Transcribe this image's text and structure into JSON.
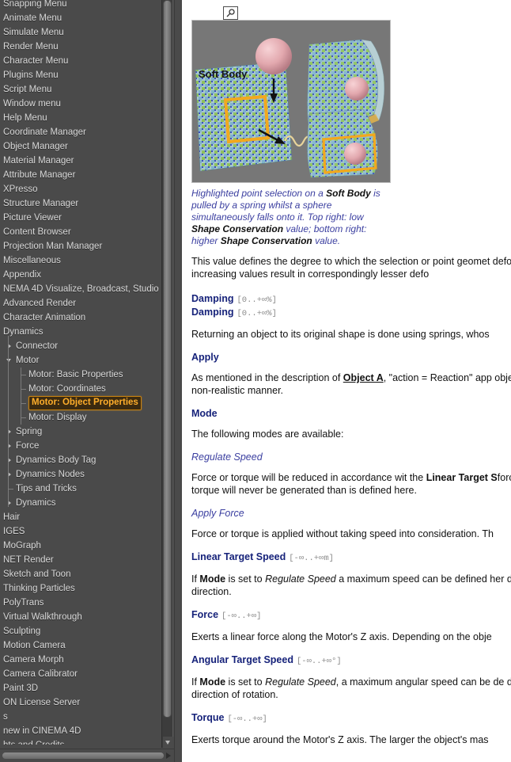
{
  "sidebar": {
    "items": [
      {
        "label": "Snapping Menu",
        "depth": 0,
        "twisty": "none",
        "selected": false,
        "clipped_top": true
      },
      {
        "label": "Animate Menu",
        "depth": 0,
        "twisty": "none",
        "selected": false
      },
      {
        "label": "Simulate Menu",
        "depth": 0,
        "twisty": "none",
        "selected": false
      },
      {
        "label": "Render Menu",
        "depth": 0,
        "twisty": "none",
        "selected": false
      },
      {
        "label": "Character Menu",
        "depth": 0,
        "twisty": "none",
        "selected": false
      },
      {
        "label": "Plugins Menu",
        "depth": 0,
        "twisty": "none",
        "selected": false
      },
      {
        "label": "Script Menu",
        "depth": 0,
        "twisty": "none",
        "selected": false
      },
      {
        "label": "Window menu",
        "depth": 0,
        "twisty": "none",
        "selected": false
      },
      {
        "label": "Help Menu",
        "depth": 0,
        "twisty": "none",
        "selected": false
      },
      {
        "label": "Coordinate Manager",
        "depth": 0,
        "twisty": "none",
        "selected": false
      },
      {
        "label": "Object Manager",
        "depth": 0,
        "twisty": "none",
        "selected": false
      },
      {
        "label": "Material Manager",
        "depth": 0,
        "twisty": "none",
        "selected": false
      },
      {
        "label": "Attribute Manager",
        "depth": 0,
        "twisty": "none",
        "selected": false
      },
      {
        "label": "XPresso",
        "depth": 0,
        "twisty": "none",
        "selected": false
      },
      {
        "label": "Structure Manager",
        "depth": 0,
        "twisty": "none",
        "selected": false
      },
      {
        "label": "Picture Viewer",
        "depth": 0,
        "twisty": "none",
        "selected": false
      },
      {
        "label": "Content Browser",
        "depth": 0,
        "twisty": "none",
        "selected": false
      },
      {
        "label": "Projection Man Manager",
        "depth": 0,
        "twisty": "none",
        "selected": false
      },
      {
        "label": "Miscellaneous",
        "depth": 0,
        "twisty": "none",
        "selected": false
      },
      {
        "label": "Appendix",
        "depth": 0,
        "twisty": "none",
        "selected": false
      },
      {
        "label": "NEMA 4D Visualize, Broadcast, Studio",
        "depth": 0,
        "twisty": "none",
        "selected": false
      },
      {
        "label": "Advanced Render",
        "depth": 0,
        "twisty": "none",
        "selected": false
      },
      {
        "label": "Character Animation",
        "depth": 0,
        "twisty": "none",
        "selected": false
      },
      {
        "label": "Dynamics",
        "depth": 0,
        "twisty": "none",
        "selected": false
      },
      {
        "label": "Connector",
        "depth": 1,
        "twisty": "closed",
        "selected": false
      },
      {
        "label": "Motor",
        "depth": 1,
        "twisty": "open",
        "selected": false
      },
      {
        "label": "Motor: Basic Properties",
        "depth": 2,
        "twisty": "leaf",
        "selected": false
      },
      {
        "label": "Motor: Coordinates",
        "depth": 2,
        "twisty": "leaf",
        "selected": false
      },
      {
        "label": "Motor: Object Properties",
        "depth": 2,
        "twisty": "leaf",
        "selected": true
      },
      {
        "label": "Motor: Display",
        "depth": 2,
        "twisty": "leaf",
        "selected": false
      },
      {
        "label": "Spring",
        "depth": 1,
        "twisty": "closed",
        "selected": false
      },
      {
        "label": "Force",
        "depth": 1,
        "twisty": "closed",
        "selected": false
      },
      {
        "label": "Dynamics Body Tag",
        "depth": 1,
        "twisty": "closed",
        "selected": false
      },
      {
        "label": "Dynamics Nodes",
        "depth": 1,
        "twisty": "closed",
        "selected": false
      },
      {
        "label": "Tips and Tricks",
        "depth": 1,
        "twisty": "leaf",
        "selected": false
      },
      {
        "label": "Dynamics",
        "depth": 1,
        "twisty": "closed",
        "selected": false
      },
      {
        "label": "Hair",
        "depth": 0,
        "twisty": "none",
        "selected": false
      },
      {
        "label": "IGES",
        "depth": 0,
        "twisty": "none",
        "selected": false
      },
      {
        "label": "MoGraph",
        "depth": 0,
        "twisty": "none",
        "selected": false
      },
      {
        "label": "NET Render",
        "depth": 0,
        "twisty": "none",
        "selected": false
      },
      {
        "label": "Sketch and Toon",
        "depth": 0,
        "twisty": "none",
        "selected": false
      },
      {
        "label": "Thinking Particles",
        "depth": 0,
        "twisty": "none",
        "selected": false
      },
      {
        "label": "PolyTrans",
        "depth": 0,
        "twisty": "none",
        "selected": false
      },
      {
        "label": "Virtual Walkthrough",
        "depth": 0,
        "twisty": "none",
        "selected": false
      },
      {
        "label": "Sculpting",
        "depth": 0,
        "twisty": "none",
        "selected": false
      },
      {
        "label": "Motion Camera",
        "depth": 0,
        "twisty": "none",
        "selected": false
      },
      {
        "label": "Camera Morph",
        "depth": 0,
        "twisty": "none",
        "selected": false
      },
      {
        "label": "Camera Calibrator",
        "depth": 0,
        "twisty": "none",
        "selected": false
      },
      {
        "label": "Paint 3D",
        "depth": 0,
        "twisty": "none",
        "selected": false
      },
      {
        "label": "ON License Server",
        "depth": 0,
        "twisty": "none",
        "selected": false
      },
      {
        "label": "s",
        "depth": 0,
        "twisty": "none",
        "selected": false
      },
      {
        "label": "new in CINEMA 4D",
        "depth": 0,
        "twisty": "none",
        "selected": false
      },
      {
        "label": "hts and Credits",
        "depth": 0,
        "twisty": "none",
        "selected": false
      }
    ],
    "selected_label": "Motor: Object Properties",
    "selection_color": "#ffae2b",
    "background_color": "#4a4a4a"
  },
  "content": {
    "zoom_icon": "magnifier-icon",
    "figure": {
      "label": "Soft Body",
      "alt": "Soft body cloth plane with highlighted point selection pulled by a spring while a sphere falls onto it; two result views at right"
    },
    "caption": {
      "part1": "Highlighted point selection on a ",
      "bold1": "Soft Body",
      "part2": " is pulled by a spring whilst a sphere simultaneously falls onto it. Top right: low ",
      "bold2": "Shape Conservation",
      "part3": " value; bottom right: higher ",
      "bold3": "Shape Conservation",
      "part4": " value."
    },
    "para_shape": "This value defines the degree to which the selection or point geomet deformations; increasing values result in correspondingly lesser defo",
    "damping_1": {
      "title": "Damping",
      "range": "[0..+∞%]"
    },
    "damping_2": {
      "title": "Damping",
      "range": "[0..+∞%]"
    },
    "para_damping": "Returning an object to its original shape is done using springs, whos",
    "apply": {
      "title": "Apply"
    },
    "para_apply_1": "As mentioned in the description of ",
    "para_apply_link": "Object A",
    "para_apply_2": ", \"action = Reaction\" app objects in a non-realistic manner.",
    "mode": {
      "title": "Mode"
    },
    "para_mode": "The following modes are available:",
    "sub_regulate": "Regulate Speed",
    "para_regulate_1": "Force or torque will be reduced in accordance wit the ",
    "para_regulate_bold": "Linear Target S",
    "para_regulate_2": "force or torque will never be generated than is defined here.",
    "sub_applyforce": "Apply Force",
    "para_applyforce": "Force or torque is applied without taking speed into consideration. Th",
    "linear_target_speed": {
      "title": "Linear Target Speed",
      "range": "[-∞..+∞m]"
    },
    "para_lts_1": "If ",
    "para_lts_mode": "Mode",
    "para_lts_2": " is set to ",
    "para_lts_it": "Regulate Speed",
    "para_lts_3": " a maximum speed can be defined her defines the direction.",
    "force": {
      "title": "Force",
      "range": "[-∞..+∞]"
    },
    "para_force": "Exerts a linear force along the Motor's Z axis. Depending on the obje",
    "angular_target_speed": {
      "title": "Angular Target Speed",
      "range": "[-∞..+∞°]"
    },
    "para_ats_1": "If ",
    "para_ats_mode": "Mode",
    "para_ats_2": " is set to ",
    "para_ats_it": "Regulate Speed",
    "para_ats_3": ", a maximum angular speed can be de defines the direction of rotation.",
    "torque": {
      "title": "Torque",
      "range": "[-∞..+∞]"
    },
    "para_torque": "Exerts torque around the Motor's Z axis. The larger the object's mas"
  }
}
